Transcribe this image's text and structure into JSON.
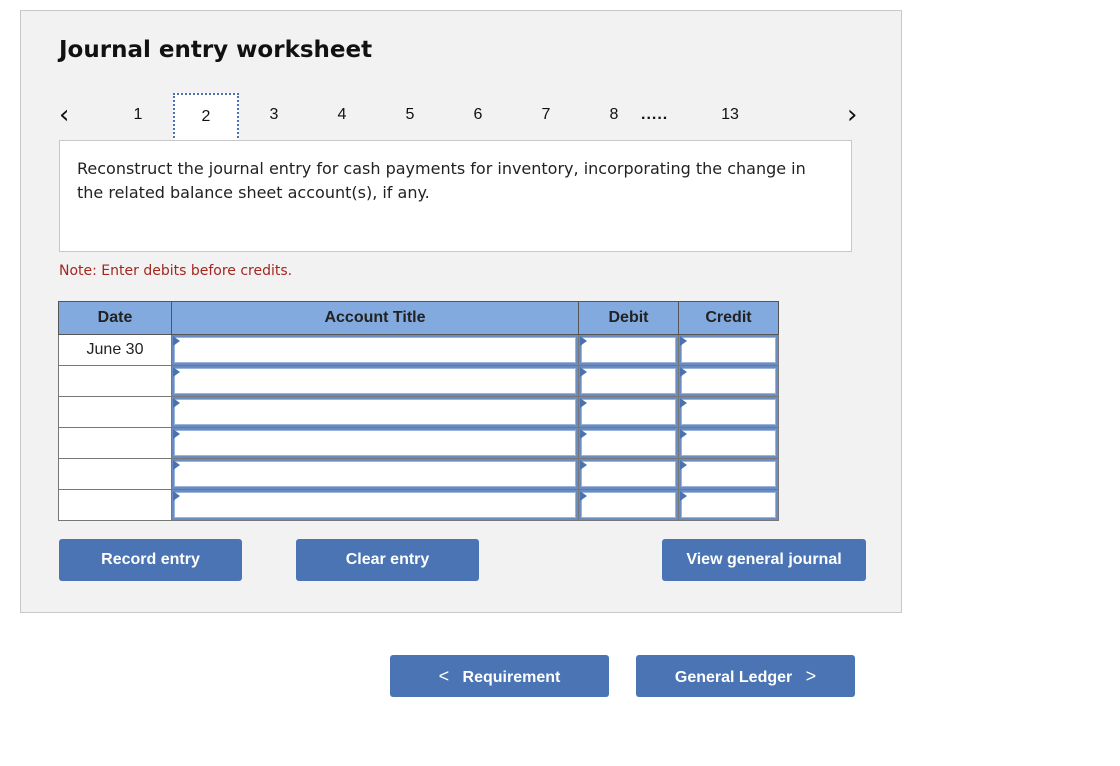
{
  "worksheet": {
    "title": "Journal entry worksheet",
    "pager": {
      "prev_icon": "chevron-left-icon",
      "next_icon": "chevron-right-icon",
      "pages": [
        "1",
        "2",
        "3",
        "4",
        "5",
        "6",
        "7",
        "8"
      ],
      "ellipsis": ".....",
      "last_page": "13",
      "active_page": "2"
    },
    "prompt": "Reconstruct the journal entry for cash payments for inventory, incorporating the change in the related balance sheet account(s), if any.",
    "note": "Note: Enter debits before credits.",
    "table": {
      "headers": [
        "Date",
        "Account Title",
        "Debit",
        "Credit"
      ],
      "rows": [
        {
          "date": "June 30",
          "account": "",
          "debit": "",
          "credit": ""
        },
        {
          "date": "",
          "account": "",
          "debit": "",
          "credit": ""
        },
        {
          "date": "",
          "account": "",
          "debit": "",
          "credit": ""
        },
        {
          "date": "",
          "account": "",
          "debit": "",
          "credit": ""
        },
        {
          "date": "",
          "account": "",
          "debit": "",
          "credit": ""
        },
        {
          "date": "",
          "account": "",
          "debit": "",
          "credit": ""
        }
      ]
    },
    "buttons": {
      "record": "Record entry",
      "clear": "Clear entry",
      "view_journal": "View general journal"
    }
  },
  "navigation": {
    "prev_label": "Requirement",
    "prev_chevron": "<",
    "next_label": "General Ledger",
    "next_chevron": ">"
  },
  "colors": {
    "header_blue": "#82aade",
    "button_blue": "#4a74b3",
    "note_red": "#a4261f"
  }
}
